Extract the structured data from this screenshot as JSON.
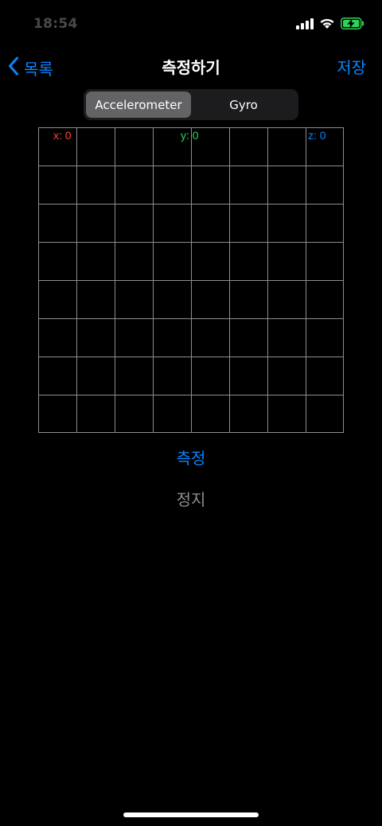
{
  "status_bar": {
    "time": "18:54",
    "icons": [
      "cellular-signal-icon",
      "wifi-icon",
      "battery-charging-icon"
    ],
    "battery_color": "#30d158"
  },
  "nav": {
    "back_label": "목록",
    "title": "측정하기",
    "save_label": "저장"
  },
  "segmented": {
    "options": [
      "Accelerometer",
      "Gyro"
    ],
    "selected": "Accelerometer"
  },
  "graph": {
    "x_label": "x: 0",
    "y_label": "y: 0",
    "z_label": "z: 0",
    "colors": {
      "x": "#ff453a",
      "y": "#30d158",
      "z": "#0a84ff"
    }
  },
  "actions": {
    "measure_label": "측정",
    "stop_label": "정지"
  },
  "accent_color": "#0a84ff"
}
